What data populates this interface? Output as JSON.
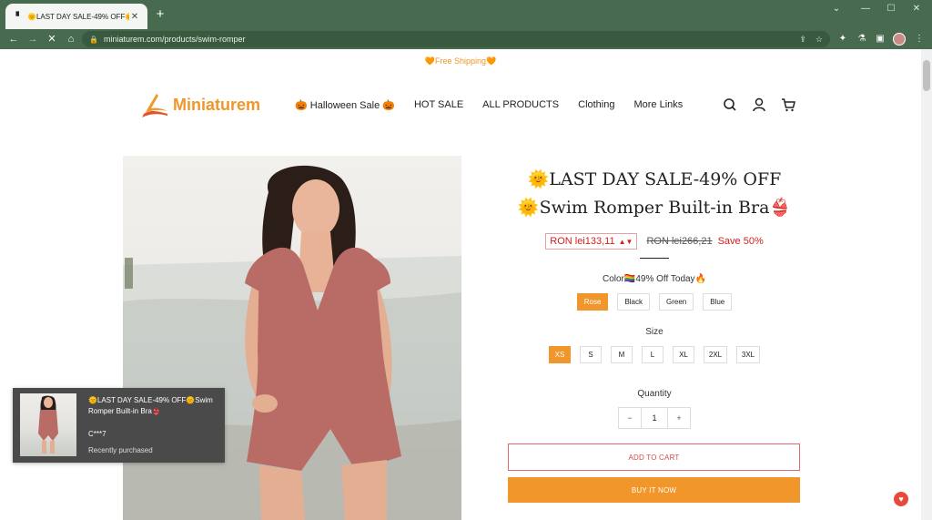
{
  "browser": {
    "tab_title": "🌞LAST DAY SALE-49% OFF🌞",
    "tab_close": "✕",
    "new_tab": "+",
    "url": "miniaturem.com/products/swim-romper",
    "window_controls": [
      "⌄",
      "—",
      "☐",
      "✕"
    ]
  },
  "announcement": "🧡Free Shipping🧡",
  "logo": {
    "text": "Miniaturem"
  },
  "nav": {
    "items": [
      "🎃 Halloween Sale 🎃",
      "HOT SALE",
      "ALL PRODUCTS",
      "Clothing",
      "More Links"
    ]
  },
  "product": {
    "title_line1": "🌞LAST DAY SALE-49% OFF",
    "title_line2": "🌞Swim Romper Built-in Bra👙",
    "price": "RON lei133,11",
    "compare_price": "RON lei266,21",
    "save": "Save 50%",
    "color_label": "Color🏳️‍🌈49% Off Today🔥",
    "colors": [
      "Rose",
      "Black",
      "Green",
      "Blue"
    ],
    "selected_color": "Rose",
    "size_label": "Size",
    "sizes": [
      "XS",
      "S",
      "M",
      "L",
      "XL",
      "2XL",
      "3XL"
    ],
    "selected_size": "XS",
    "quantity_label": "Quantity",
    "quantity": "1",
    "minus": "−",
    "plus": "+",
    "add_to_cart": "ADD TO CART",
    "buy_now": "BUY IT NOW"
  },
  "popup": {
    "text": "🌞LAST DAY SALE-49% OFF🌞Swim Romper Built-in Bra👙",
    "buyer": "C***7",
    "status": "Recently purchased"
  },
  "colors": {
    "chrome": "#486b4f",
    "accent": "#f0962a",
    "sale_red": "#d21f1f"
  }
}
